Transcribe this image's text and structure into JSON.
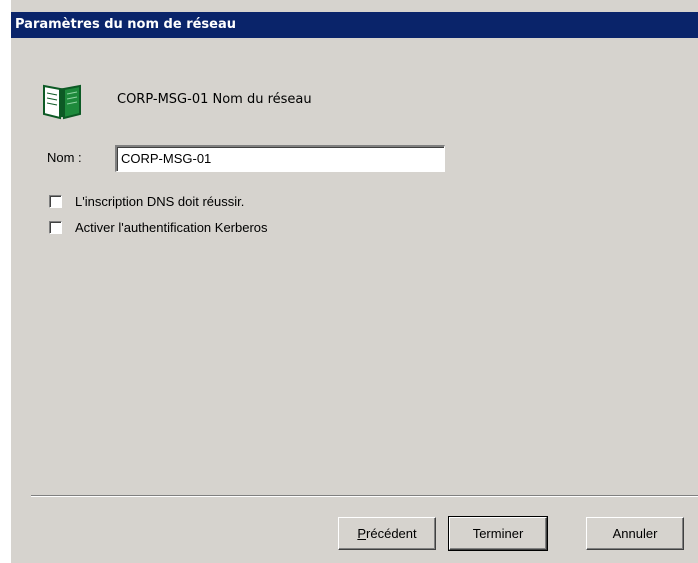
{
  "window": {
    "title": "Paramètres du nom de réseau"
  },
  "header": {
    "icon": "book-icon",
    "text": "CORP-MSG-01 Nom du réseau"
  },
  "name_field": {
    "label": "Nom :",
    "value": "CORP-MSG-01"
  },
  "options": [
    {
      "label": "L'inscription DNS doit réussir.",
      "checked": false
    },
    {
      "label": "Activer l'authentification Kerberos",
      "checked": false
    }
  ],
  "buttons": {
    "back_first": "P",
    "back_rest": "récédent",
    "finish": "Terminer",
    "cancel": "Annuler"
  },
  "colors": {
    "titlebar": "#0a246a",
    "dialog_bg": "#d6d3ce",
    "icon_green": "#1e8a3c"
  }
}
